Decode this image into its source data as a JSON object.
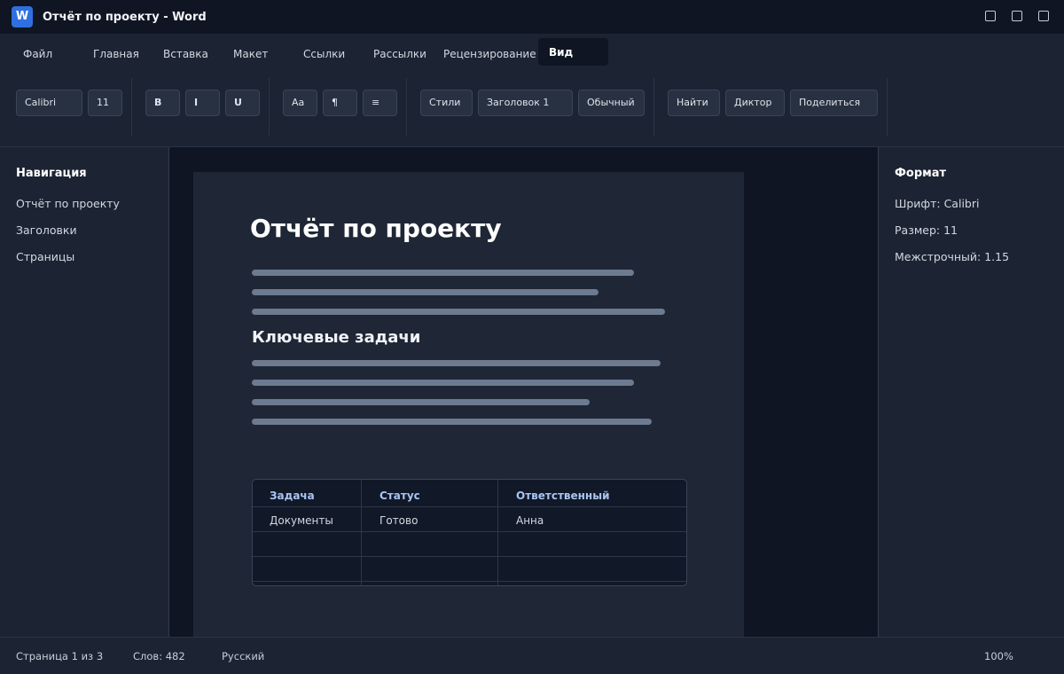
{
  "window": {
    "title": "Отчёт по проекту - Word",
    "app_icon_letter": "W"
  },
  "tabs": [
    "Файл",
    "Главная",
    "Вставка",
    "Макет",
    "Ссылки",
    "Рассылки",
    "Рецензирование",
    "Вид"
  ],
  "active_tab": "Вид",
  "ribbon": {
    "font_name": "Calibri",
    "font_size": "11",
    "bold": "B",
    "italic": "I",
    "underline": "U",
    "change_case": "Aa",
    "paragraph_mark": "¶",
    "align": "≡",
    "styles": "Стили",
    "style_heading1": "Заголовок 1",
    "style_normal": "Обычный",
    "find": "Найти",
    "dictate": "Диктор",
    "share": "Поделиться"
  },
  "navigation": {
    "title": "Навигация",
    "items": [
      "Отчёт по проекту",
      "Заголовки",
      "Страницы"
    ]
  },
  "format_panel": {
    "title": "Формат",
    "items": [
      "Шрифт: Calibri",
      "Размер: 11",
      "Межстрочный: 1.15"
    ]
  },
  "document": {
    "title": "Отчёт по проекту",
    "heading2": "Ключевые задачи",
    "table": {
      "headers": [
        "Задача",
        "Статус",
        "Ответственный"
      ],
      "rows": [
        [
          "Документы",
          "Готово",
          "Анна"
        ],
        [
          "",
          "",
          ""
        ],
        [
          "",
          "",
          ""
        ]
      ]
    }
  },
  "status": {
    "page": "Страница 1 из 3",
    "words": "Слов: 482",
    "language": "Русский",
    "zoom": "100%"
  }
}
